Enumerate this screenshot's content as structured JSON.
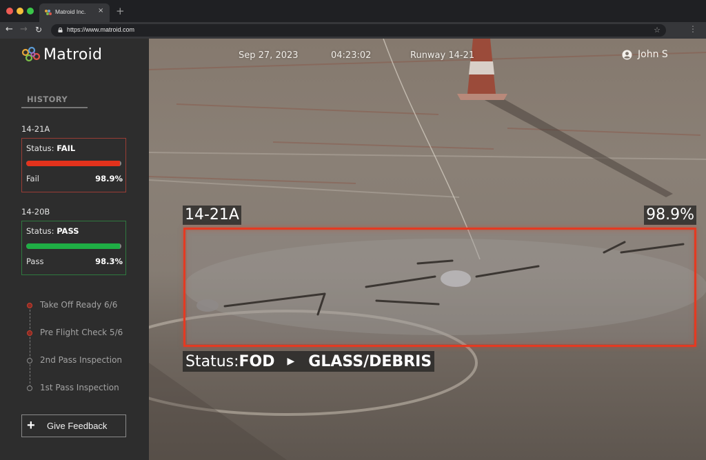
{
  "browser": {
    "tab_title": "Matroid Inc.",
    "url": "https://www.matroid.com",
    "icons": {
      "back": "arrow-left",
      "forward": "arrow-right",
      "reload": "reload",
      "lock": "lock",
      "bookmark": "star",
      "menu": "vertical-dots",
      "close_tab": "×",
      "new_tab": "+"
    }
  },
  "brand": {
    "name": "Matroid"
  },
  "header": {
    "date": "Sep 27, 2023",
    "time": "04:23:02",
    "runway": "Runway 14-21",
    "user": "John S"
  },
  "sidebar": {
    "history_label": "HISTORY",
    "history": [
      {
        "id": "14-21A",
        "status_prefix": "Status: ",
        "status": "FAIL",
        "result": "Fail",
        "confidence": "98.9%",
        "confidence_value": 0.989,
        "color": "#e3321c",
        "border_color": "#9a3d35"
      },
      {
        "id": "14-20B",
        "status_prefix": "Status: ",
        "status": "PASS",
        "result": "Pass",
        "confidence": "98.3%",
        "confidence_value": 0.983,
        "color": "#1fae45",
        "border_color": "#2f7a3f"
      }
    ],
    "timeline": [
      {
        "label": "Take Off Ready 6/6",
        "active": true
      },
      {
        "label": "Pre Flight Check 5/6",
        "active": true
      },
      {
        "label": "2nd Pass Inspection",
        "active": false
      },
      {
        "label": "1st Pass Inspection",
        "active": false
      }
    ],
    "feedback_label": "Give Feedback"
  },
  "detection": {
    "id": "14-21A",
    "confidence": "98.9%",
    "status_prefix": "Status: ",
    "status": "FOD",
    "category": "GLASS/DEBRIS",
    "box_color": "#e43a22"
  }
}
